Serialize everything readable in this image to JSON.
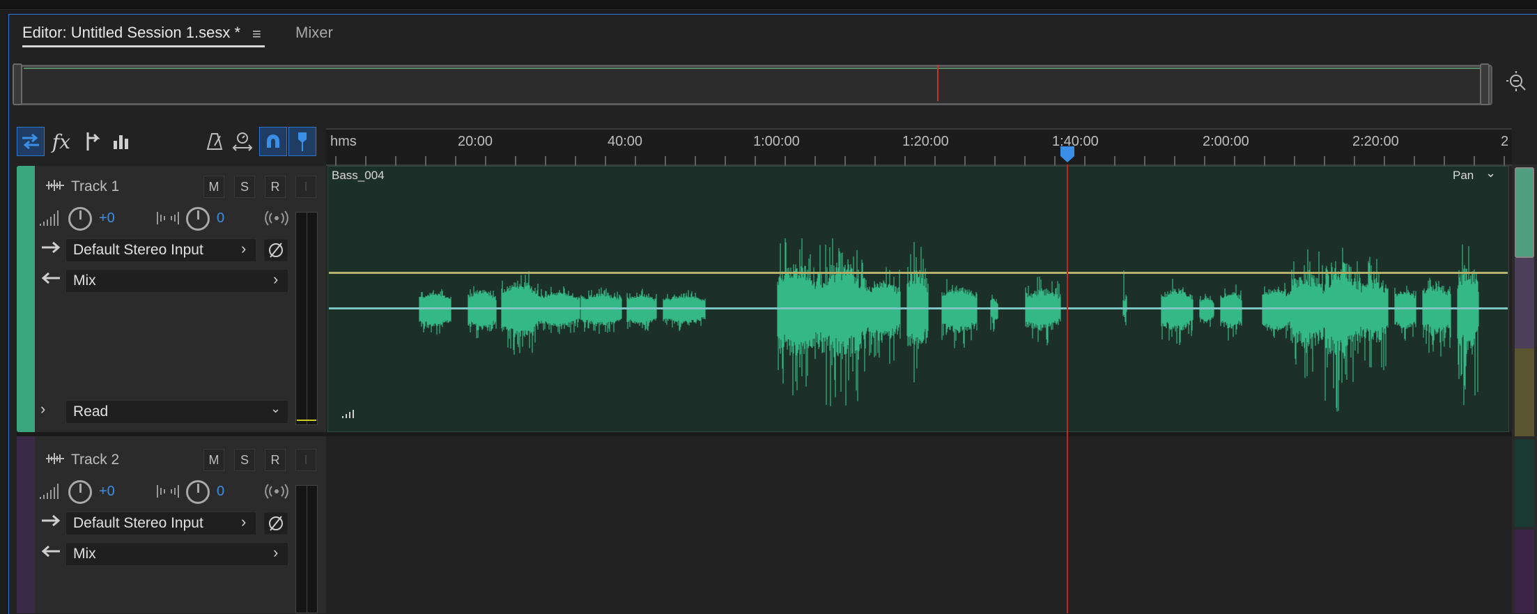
{
  "editor_tab": {
    "label": "Editor: Untitled Session 1.sesx *",
    "menu_glyph": "≡"
  },
  "mixer_tab": {
    "label": "Mixer"
  },
  "ruler": {
    "unit": "hms",
    "ticks": [
      "20:00",
      "40:00",
      "1:00:00",
      "1:20:00",
      "1:40:00",
      "2:00:00",
      "2:20:00",
      "2"
    ]
  },
  "colors": {
    "accent": "#2e76d6",
    "track1": "#3aa57e",
    "track2": "#3b2a47",
    "playhead": "#c8241f",
    "waveform": "#35b886",
    "volume_envelope": "#b5b36a",
    "pan_envelope": "#7cc6c4"
  },
  "tracks": [
    {
      "name": "Track 1",
      "mute": "M",
      "solo": "S",
      "record": "R",
      "input_monitor": "I",
      "volume": "+0",
      "pan": "0",
      "input": "Default Stereo Input",
      "output": "Mix",
      "automation": "Read",
      "clip_name": "Bass_004",
      "clip_envelope": "Pan"
    },
    {
      "name": "Track 2",
      "mute": "M",
      "solo": "S",
      "record": "R",
      "input_monitor": "I",
      "volume": "+0",
      "pan": "0",
      "input": "Default Stereo Input",
      "output": "Mix"
    }
  ],
  "toolbar_icons": [
    "switch-icon",
    "fx-icon",
    "send-icon",
    "eq-icon",
    "metronome-icon",
    "time-stretch-icon",
    "snap-icon",
    "marker-icon"
  ]
}
